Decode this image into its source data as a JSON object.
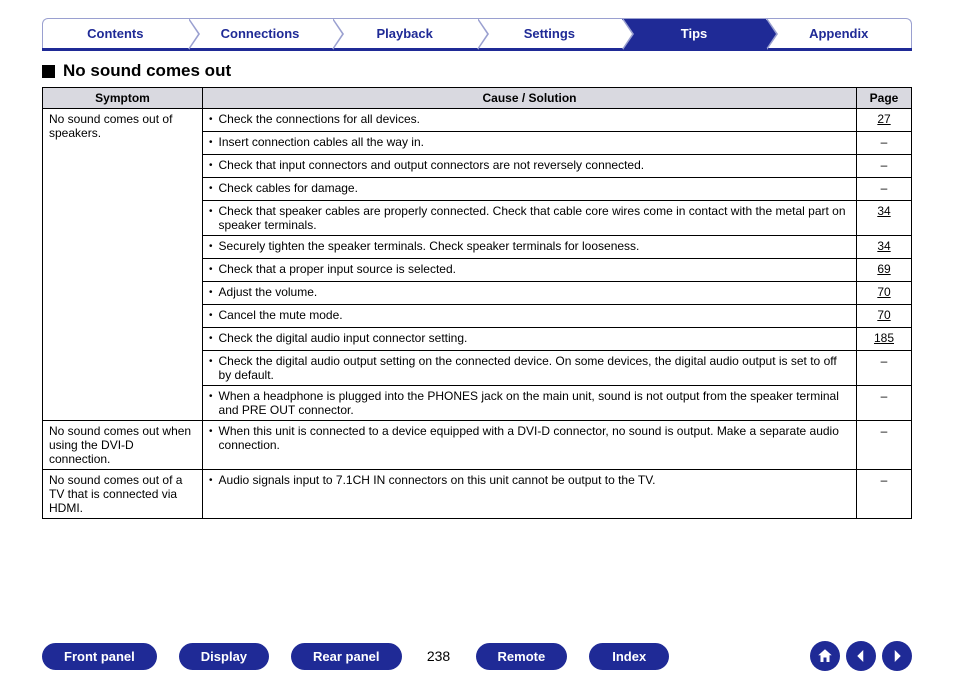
{
  "tabs": {
    "contents": "Contents",
    "connections": "Connections",
    "playback": "Playback",
    "settings": "Settings",
    "tips": "Tips",
    "appendix": "Appendix",
    "active": "tips"
  },
  "section_title": "No sound comes out",
  "table": {
    "headers": {
      "symptom": "Symptom",
      "cause": "Cause / Solution",
      "page": "Page"
    },
    "groups": [
      {
        "symptom": "No sound comes out of speakers.",
        "rows": [
          {
            "cause": "Check the connections for all devices.",
            "page": "27"
          },
          {
            "cause": "Insert connection cables all the way in.",
            "page": "–"
          },
          {
            "cause": "Check that input connectors and output connectors are not reversely connected.",
            "page": "–"
          },
          {
            "cause": "Check cables for damage.",
            "page": "–"
          },
          {
            "cause": "Check that speaker cables are properly connected. Check that cable core wires come in contact with the metal part on speaker terminals.",
            "page": "34"
          },
          {
            "cause": "Securely tighten the speaker terminals. Check speaker terminals for looseness.",
            "page": "34"
          },
          {
            "cause": "Check that a proper input source is selected.",
            "page": "69"
          },
          {
            "cause": "Adjust the volume.",
            "page": "70"
          },
          {
            "cause": "Cancel the mute mode.",
            "page": "70"
          },
          {
            "cause": "Check the digital audio input connector setting.",
            "page": "185"
          },
          {
            "cause": "Check the digital audio output setting on the connected device. On some devices, the digital audio output is set to off by default.",
            "page": "–"
          },
          {
            "cause": "When a headphone is plugged into the PHONES jack on the main unit, sound is not output from the speaker terminal and PRE OUT connector.",
            "page": "–"
          }
        ]
      },
      {
        "symptom": "No sound comes out when using the DVI-D connection.",
        "rows": [
          {
            "cause": "When this unit is connected to a device equipped with a DVI-D connector, no sound is output. Make a separate audio connection.",
            "page": "–"
          }
        ]
      },
      {
        "symptom": "No sound comes out of a TV that is connected via HDMI.",
        "rows": [
          {
            "cause": "Audio signals input to 7.1CH IN connectors on this unit cannot be output to the TV.",
            "page": "–"
          }
        ]
      }
    ]
  },
  "bottom": {
    "front_panel": "Front panel",
    "display": "Display",
    "rear_panel": "Rear panel",
    "remote": "Remote",
    "index": "Index",
    "page_number": "238"
  }
}
